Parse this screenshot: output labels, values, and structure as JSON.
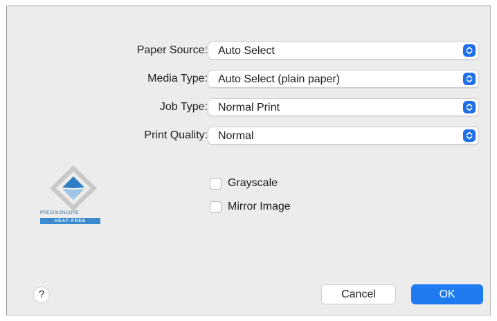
{
  "settings": [
    {
      "label": "Paper Source:",
      "value": "Auto Select"
    },
    {
      "label": "Media Type:",
      "value": "Auto Select (plain paper)"
    },
    {
      "label": "Job Type:",
      "value": "Normal Print"
    },
    {
      "label": "Print Quality:",
      "value": "Normal"
    }
  ],
  "checkboxes": [
    {
      "label": "Grayscale",
      "checked": false
    },
    {
      "label": "Mirror Image",
      "checked": false
    }
  ],
  "logo": {
    "tagline": "PRECISIONCORE",
    "bar_text": "HEAT·FREE",
    "accent_color": "#3a8ad0"
  },
  "footer": {
    "help_label": "?",
    "cancel_label": "Cancel",
    "ok_label": "OK"
  },
  "colors": {
    "dialog_bg": "#ececec",
    "accent": "#1e7bf0"
  }
}
